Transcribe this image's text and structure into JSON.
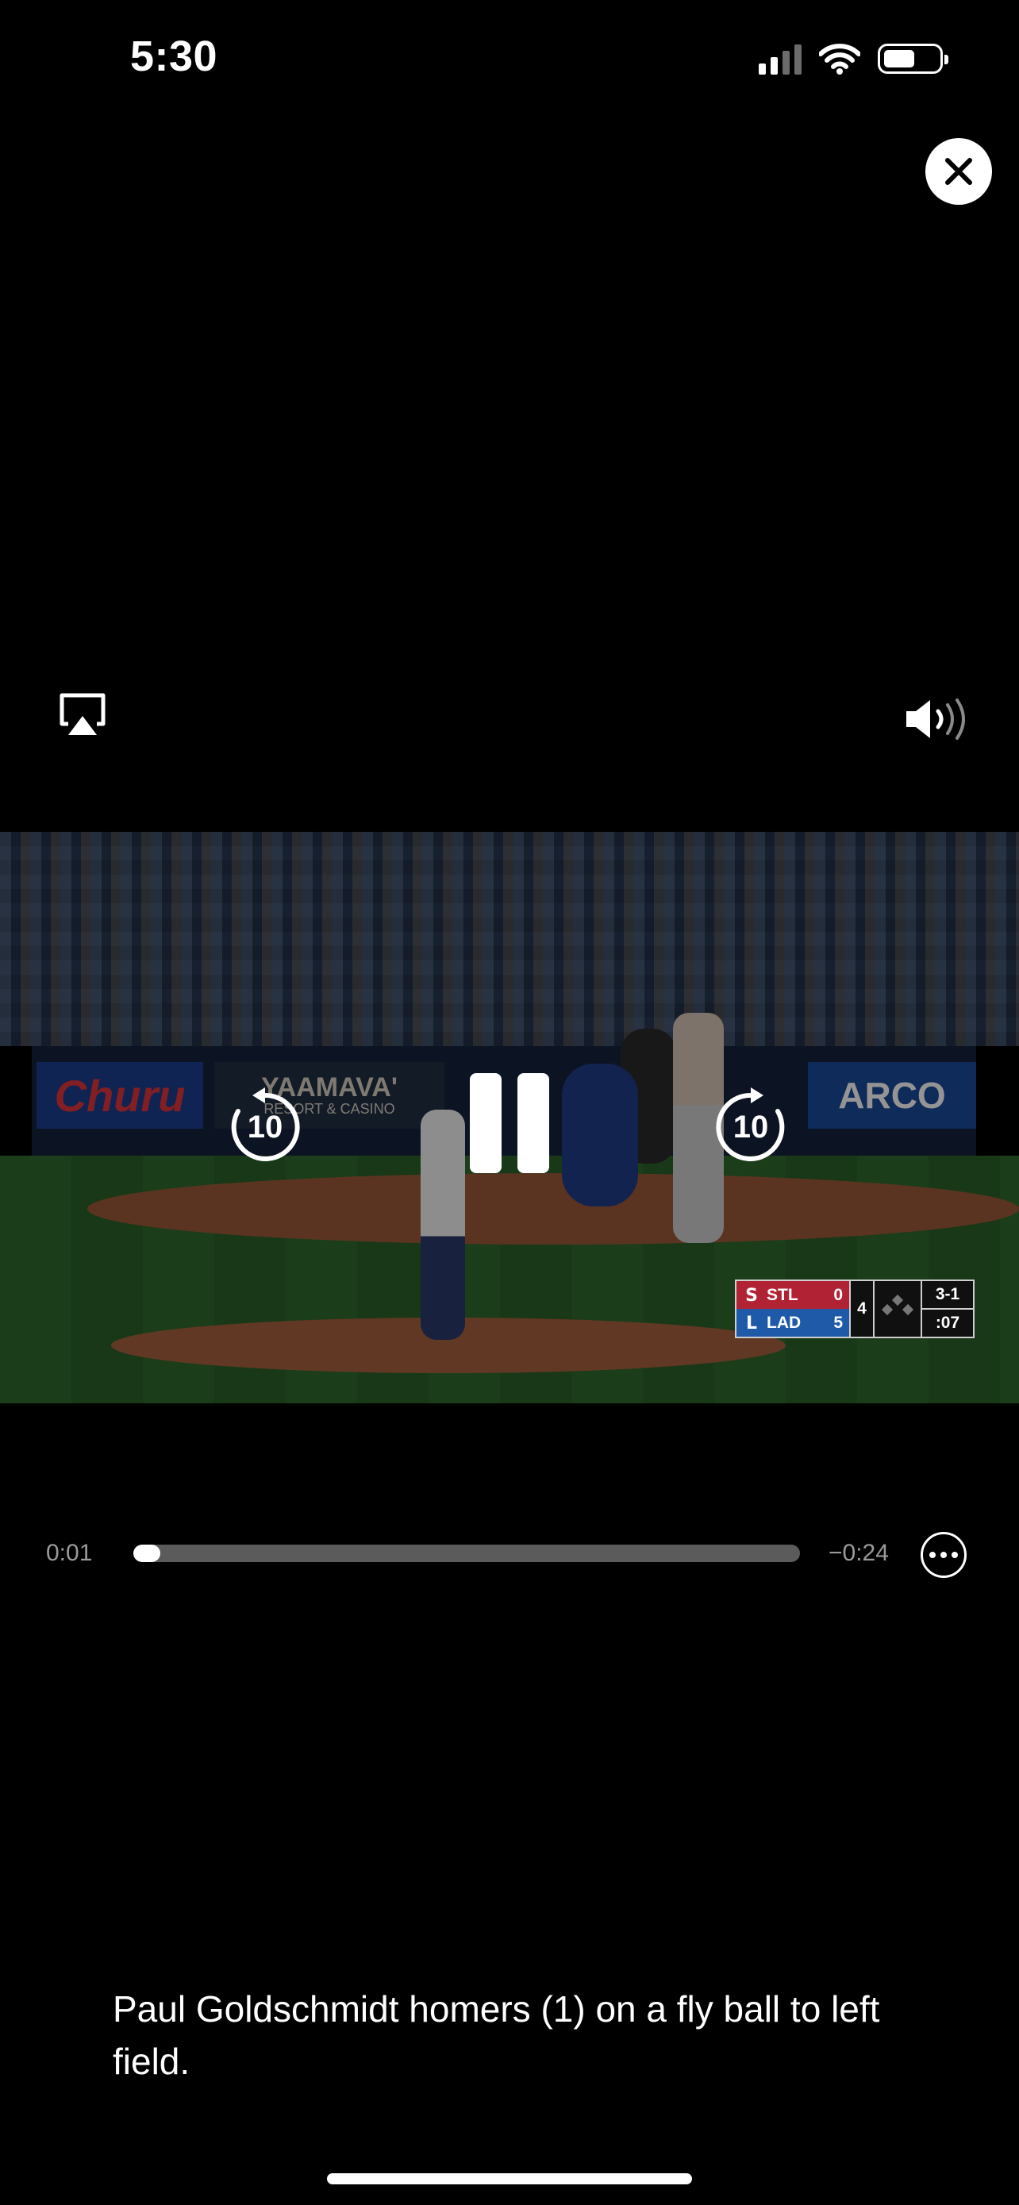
{
  "status_bar": {
    "time": "5:30",
    "icons": [
      "cellular-signal-icon",
      "wifi-icon",
      "battery-icon"
    ],
    "battery_level": 0.5
  },
  "player": {
    "close_icon": "close-icon",
    "airplay_icon": "airplay-icon",
    "volume_icon": "volume-icon",
    "skip_back_label": "10",
    "skip_forward_label": "10",
    "pause_icon": "pause-icon",
    "elapsed": "0:01",
    "remaining": "−0:24",
    "progress": 0.04,
    "more_icon": "more-options-icon"
  },
  "video_frame": {
    "ads": {
      "churu": "Churu",
      "yaamava": "YAAMAVA'",
      "yaamava_sub": "RESORT & CASINO",
      "arco": "ARCO"
    },
    "scorebug": {
      "away_team": "STL",
      "away_score": "0",
      "home_team": "LAD",
      "home_score": "5",
      "inning": "4",
      "count": "3-1",
      "pitch_clock": ":07"
    }
  },
  "caption": "Paul Goldschmidt homers (1) on a fly ball to left field.",
  "colors": {
    "background": "#000000",
    "controls": "#ffffff",
    "time_text": "#9a9a9a",
    "track": "#5b5b5b",
    "stl_red": "#b22235",
    "lad_blue": "#1e5aa8"
  }
}
